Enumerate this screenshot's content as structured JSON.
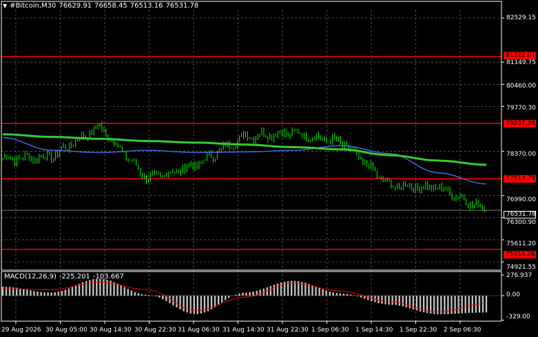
{
  "header": {
    "symbol": "#Bitcoin,M30",
    "open": "76629.91",
    "high": "76658.45",
    "low": "76513.16",
    "close": "76531.78"
  },
  "macd": {
    "label": "MACD(12,26,9)",
    "main": "-225.201",
    "signal": "-103.667",
    "axis_labels": [
      "276.937",
      "0.00",
      "-329.00"
    ],
    "histogram_color": "#c0c0c0",
    "signal_color": "#ff0000"
  },
  "price_axis": {
    "labels": [
      "82529.15",
      "81149.75",
      "80460.00",
      "79770.30",
      "78370.00",
      "76990.00",
      "76300.90",
      "75611.20",
      "74921.55"
    ]
  },
  "levels": [
    {
      "label": "81322.01",
      "value": 81322.01
    },
    {
      "label": "79237.38",
      "value": 79237.38
    },
    {
      "label": "77513.79",
      "value": 77513.79
    },
    {
      "label": "75314.26",
      "value": 75314.26
    }
  ],
  "current_price": {
    "label": "76531.78",
    "value": 76531.78
  },
  "time_axis": {
    "labels": [
      "29 Aug 2026",
      "30 Aug 05:00",
      "30 Aug 14:30",
      "30 Aug 22:30",
      "31 Aug 06:30",
      "31 Aug 14:30",
      "31 Aug 22:30",
      "1 Sep 06:30",
      "1 Sep 14:30",
      "1 Sep 22:30",
      "2 Sep 06:30"
    ]
  },
  "colors": {
    "background": "#000000",
    "candle": "#00ff00",
    "level": "#ff0000",
    "ma_fast": "#4169e1",
    "ma_slow": "#32cd32",
    "grid": "#c0c0c0"
  },
  "chart_data": {
    "type": "line",
    "symbol": "#Bitcoin",
    "timeframe": "M30",
    "x": [
      "29 Aug 2026",
      "30 Aug 05:00",
      "30 Aug 14:30",
      "30 Aug 22:30",
      "31 Aug 06:30",
      "31 Aug 14:30",
      "31 Aug 22:30",
      "1 Sep 06:30",
      "1 Sep 14:30",
      "1 Sep 22:30",
      "2 Sep 06:30"
    ],
    "series": [
      {
        "values": [
          78150,
          78200,
          79150,
          77500,
          77950,
          78850,
          78950,
          78650,
          77300,
          77250,
          76531.78
        ]
      },
      {
        "values": [
          78800,
          78400,
          78330,
          78400,
          78330,
          78350,
          78400,
          78550,
          78300,
          77700,
          77350
        ]
      },
      {
        "values": [
          78900,
          78820,
          78760,
          78690,
          78640,
          78580,
          78500,
          78430,
          78250,
          78080,
          77950
        ]
      }
    ],
    "macd_main": [
      120,
      40,
      230,
      10,
      -250,
      40,
      200,
      30,
      -120,
      -250,
      -225.201
    ],
    "macd_signal": [
      90,
      80,
      180,
      80,
      -200,
      -20,
      170,
      60,
      -80,
      -220,
      -103.667
    ],
    "ylim": [
      74921.55,
      82529.15
    ],
    "grid": true
  }
}
